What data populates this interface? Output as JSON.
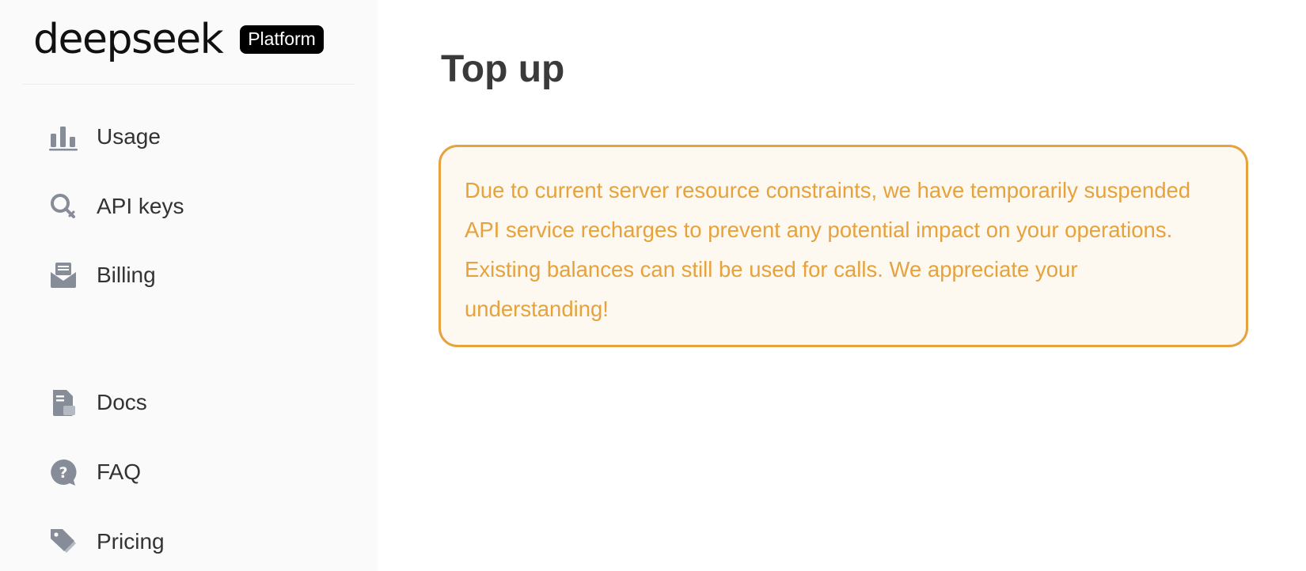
{
  "brand": {
    "logo_text": "deepseek",
    "badge": "Platform"
  },
  "sidebar": {
    "items": [
      {
        "label": "Usage",
        "icon": "bar-chart-icon"
      },
      {
        "label": "API keys",
        "icon": "key-search-icon"
      },
      {
        "label": "Billing",
        "icon": "billing-envelope-icon"
      },
      {
        "label": "Docs",
        "icon": "document-icon"
      },
      {
        "label": "FAQ",
        "icon": "question-bubble-icon"
      },
      {
        "label": "Pricing",
        "icon": "price-tag-icon"
      }
    ]
  },
  "main": {
    "title": "Top up",
    "notice": "Due to current server resource constraints, we have temporarily suspended API service recharges to prevent any potential impact on your operations. Existing balances can still be used for calls. We appreciate your understanding!"
  },
  "colors": {
    "icon": "#868c98",
    "notice_text": "#e6a23c",
    "notice_border": "#e6a23c",
    "notice_bg": "#fdf8f0",
    "sidebar_bg": "#fafafa"
  }
}
